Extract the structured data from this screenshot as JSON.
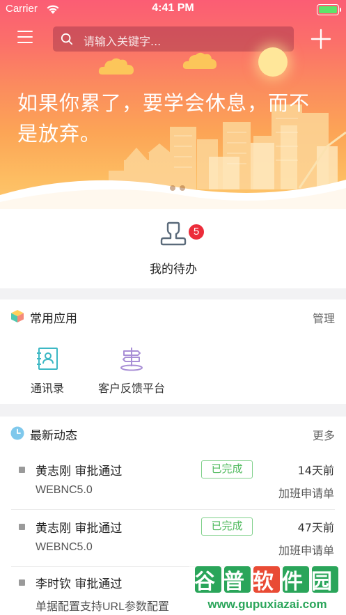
{
  "status_bar": {
    "carrier": "Carrier",
    "time": "4:41 PM"
  },
  "header": {
    "search_placeholder": "请输入关键字..."
  },
  "banner": {
    "slogan": "如果你累了，要学会休息，而不是放弃。",
    "page_dots": 2
  },
  "todo": {
    "label": "我的待办",
    "badge": "5"
  },
  "apps": {
    "title": "常用应用",
    "action": "管理",
    "items": [
      {
        "label": "通讯录",
        "icon": "contacts-icon"
      },
      {
        "label": "客户反馈平台",
        "icon": "signpost-icon"
      }
    ]
  },
  "news": {
    "title": "最新动态",
    "action": "更多",
    "items": [
      {
        "title": "黄志刚 审批通过",
        "subtitle": "WEBNC5.0",
        "status": "已完成",
        "time": "14天前",
        "type": "加班申请单"
      },
      {
        "title": "黄志刚 审批通过",
        "subtitle": "WEBNC5.0",
        "status": "已完成",
        "time": "47天前",
        "type": "加班申请单"
      },
      {
        "title": "李时钦 审批通过",
        "subtitle": "单据配置支持URL参数配置",
        "status": "",
        "time": "",
        "type": ""
      }
    ]
  },
  "watermark": {
    "text": "谷普软件园",
    "url": "www.gupuxiazai.com"
  },
  "colors": {
    "accent_red": "#ec2c3a",
    "status_green": "#4eb95c",
    "hero_top": "#fb5d74",
    "hero_bottom": "#fdd07a"
  }
}
